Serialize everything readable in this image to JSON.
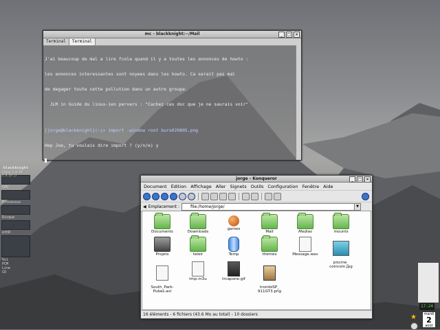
{
  "terminal": {
    "window_title": "mc - blackknight:~/Mail",
    "tabs": [
      "Terminal",
      "Terminal"
    ],
    "lines": [
      "J'ai beaucoup de mal a lire fcola quand il y a toutes les annonces de howto :",
      "les annonces interessantes sont noyees dans les howto. Ca serait pas mal",
      "de degager toute cette pollution dans un autre groupe.",
      "  JLM in Guide du linux-ien pervers : \"Cachez ces doc que je ne saurais voir\"",
      "",
      "[jorge@blackknight](~)> import -window root buro020805.png",
      "Hep Joe, tu voulais dire import ? (y/n/e) y"
    ]
  },
  "konqueror": {
    "window_title": "jorge - Konqueror",
    "menu": [
      "Document",
      "Édition",
      "Affichage",
      "Aller",
      "Signets",
      "Outils",
      "Configuration",
      "Fenêtre",
      "Aide"
    ],
    "location_label": "Emplacement :",
    "location_value": "file:/home/jorge/",
    "status": "16 éléments - 6 fichiers (43.6 Mo au total) - 10 dossiers",
    "items": [
      {
        "name": "Documents",
        "kind": "folder"
      },
      {
        "name": "Downloads",
        "kind": "folder"
      },
      {
        "name": "games",
        "kind": "games"
      },
      {
        "name": "Mail",
        "kind": "folder"
      },
      {
        "name": "Medias",
        "kind": "folder"
      },
      {
        "name": "mounts",
        "kind": "folder"
      },
      {
        "name": "Projets",
        "kind": "projets"
      },
      {
        "name": "teleir",
        "kind": "folder"
      },
      {
        "name": "Temp",
        "kind": "temp"
      },
      {
        "name": "themes",
        "kind": "folder"
      },
      {
        "name": "Message.wav",
        "kind": "file"
      },
      {
        "name": "piscine_\ncoincoin.jpg",
        "kind": "image"
      },
      {
        "name": "South_Park-\nPubes.avi",
        "kind": "file"
      },
      {
        "name": "tmp.m3u",
        "kind": "file"
      },
      {
        "name": "trcapone.gif",
        "kind": "image"
      },
      {
        "name": "trombiSP_\n911GT3.png",
        "kind": "image"
      }
    ]
  },
  "gkrellm": {
    "hostname": "blackknight",
    "uptime": "Linux 2.4.18 2.4.22-jr",
    "cpu_label": "CPU",
    "proc_label": "Processus",
    "disk_label": "Disque",
    "eth_label": "eth0",
    "labels": [
      "Vol",
      "PCM",
      "Line",
      "CD"
    ]
  },
  "dock": {
    "clock": "17:24",
    "weekday": "mardi",
    "day": "2",
    "month": "août"
  }
}
